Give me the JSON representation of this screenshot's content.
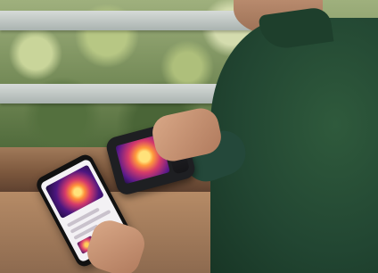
{
  "scene": {
    "subject": "person-holding-thermal-camera-and-smartphone",
    "palette": {
      "shirt": "#224632",
      "skin": "#c99474",
      "wood": "#7a563c",
      "foliage": "#6d8451",
      "thermal_hot": "#ffe27a",
      "thermal_mid": "#d63a6a",
      "thermal_cold": "#201048"
    }
  }
}
